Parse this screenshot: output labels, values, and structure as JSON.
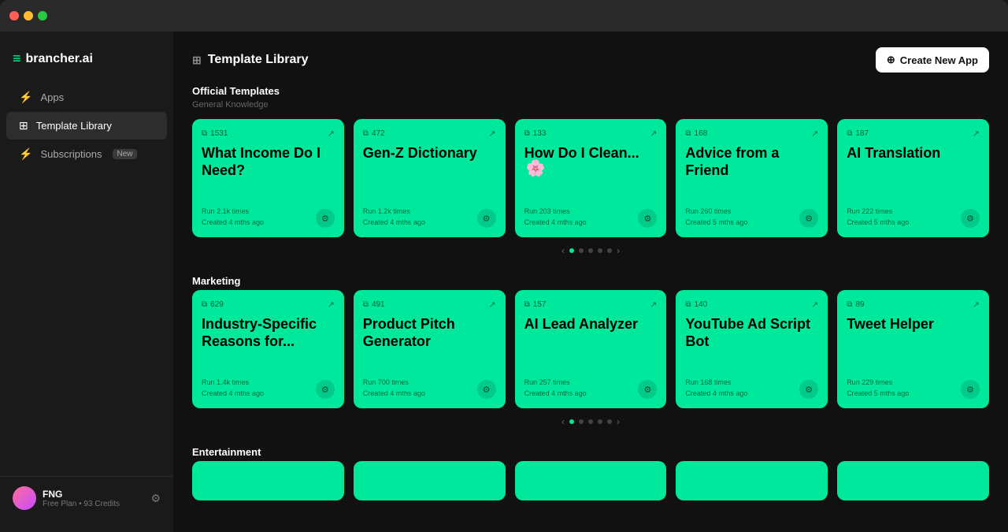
{
  "titlebar": {
    "dots": [
      "red",
      "yellow",
      "green"
    ]
  },
  "sidebar": {
    "logo": "brancher.ai",
    "logo_symbol": "≡",
    "nav_items": [
      {
        "id": "apps",
        "label": "Apps",
        "icon": "⚡",
        "active": false
      },
      {
        "id": "template-library",
        "label": "Template Library",
        "icon": "⊞",
        "active": true
      },
      {
        "id": "subscriptions",
        "label": "Subscriptions",
        "icon": "⚡",
        "active": false,
        "badge": "New"
      }
    ],
    "user": {
      "name": "FNG",
      "plan": "Free Plan • 93 Credits"
    }
  },
  "header": {
    "title": "Template Library",
    "title_icon": "⊞",
    "create_button": "Create New App",
    "create_icon": "+"
  },
  "sections": [
    {
      "id": "official-templates",
      "title": "Official Templates",
      "subtitle": "General Knowledge",
      "cards": [
        {
          "id": "what-income",
          "count": "1531",
          "title": "What Income Do I Need?",
          "run_times": "Run 2.1k times",
          "created": "Created 4 mths ago"
        },
        {
          "id": "gen-z-dict",
          "count": "472",
          "title": "Gen-Z Dictionary",
          "run_times": "Run 1.2k times",
          "created": "Created 4 mths ago"
        },
        {
          "id": "how-do-i-clean",
          "count": "133",
          "title": "How Do I Clean...",
          "has_emoji": true,
          "emoji": "🌸",
          "run_times": "Run 203 times",
          "created": "Created 4 mths ago"
        },
        {
          "id": "advice-from-friend",
          "count": "168",
          "title": "Advice from a Friend",
          "run_times": "Run 260 times",
          "created": "Created 5 mths ago"
        },
        {
          "id": "ai-translation",
          "count": "187",
          "title": "AI Translation",
          "run_times": "Run 222 times",
          "created": "Created 5 mths ago"
        }
      ],
      "pagination": {
        "total": 5,
        "active": 1
      }
    },
    {
      "id": "marketing",
      "title": "Marketing",
      "subtitle": "",
      "cards": [
        {
          "id": "industry-specific",
          "count": "629",
          "title": "Industry-Specific Reasons for...",
          "run_times": "Run 1.4k times",
          "created": "Created 4 mths ago"
        },
        {
          "id": "product-pitch",
          "count": "491",
          "title": "Product Pitch Generator",
          "run_times": "Run 700 times",
          "created": "Created 4 mths ago"
        },
        {
          "id": "ai-lead-analyzer",
          "count": "157",
          "title": "AI Lead Analyzer",
          "run_times": "Run 257 times",
          "created": "Created 4 mths ago"
        },
        {
          "id": "youtube-ad-script",
          "count": "140",
          "title": "YouTube Ad Script Bot",
          "run_times": "Run 168 times",
          "created": "Created 4 mths ago"
        },
        {
          "id": "tweet-helper",
          "count": "89",
          "title": "Tweet Helper",
          "run_times": "Run 229 times",
          "created": "Created 5 mths ago"
        }
      ],
      "pagination": {
        "total": 5,
        "active": 1
      }
    }
  ],
  "entertainment_section": {
    "title": "Entertainment",
    "cards_count": 5
  }
}
